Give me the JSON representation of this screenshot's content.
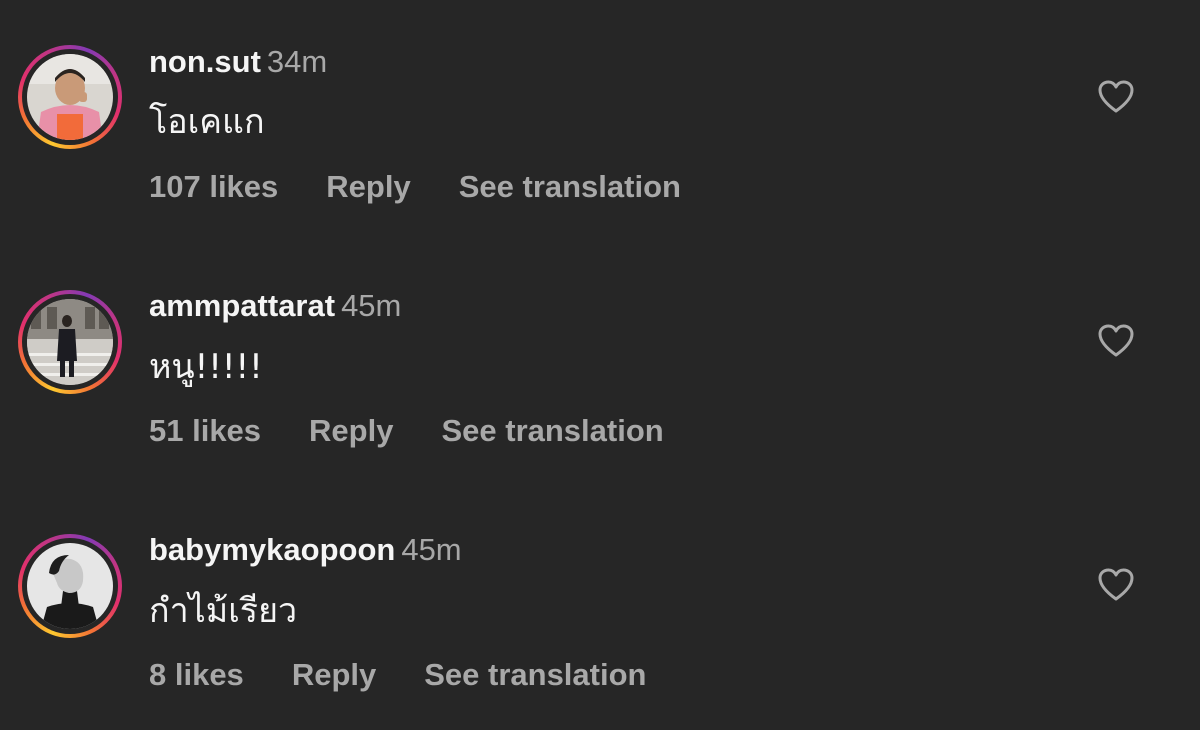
{
  "comments": [
    {
      "username": "non.sut",
      "time": "34m",
      "text": "โอเคแก",
      "likes": "107 likes",
      "reply": "Reply",
      "translate": "See translation",
      "avatar_icon": "profile-photo"
    },
    {
      "username": "ammpattarat",
      "time": "45m",
      "text": "หนู!!!!!",
      "likes": "51 likes",
      "reply": "Reply",
      "translate": "See translation",
      "avatar_icon": "profile-photo"
    },
    {
      "username": "babymykaopoon",
      "time": "45m",
      "text": "กำไม้เรียว",
      "likes": "8 likes",
      "reply": "Reply",
      "translate": "See translation",
      "avatar_icon": "profile-photo"
    }
  ],
  "icons": {
    "like": "heart-outline-icon"
  },
  "colors": {
    "background": "#262626",
    "primary_text": "#f5f5f5",
    "secondary_text": "#a8a8a8",
    "story_ring": [
      "#fdc830",
      "#f37335",
      "#e1306c",
      "#c13584",
      "#833ab4"
    ]
  }
}
